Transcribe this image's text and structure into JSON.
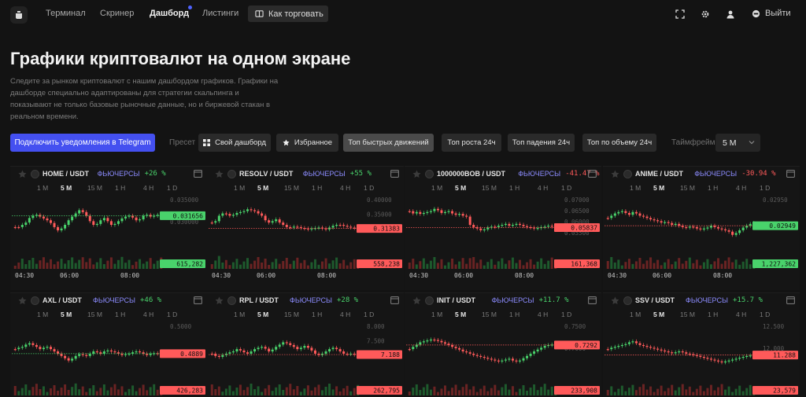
{
  "nav": {
    "items": [
      {
        "label": "Терминал",
        "active": false
      },
      {
        "label": "Скринер",
        "active": false
      },
      {
        "label": "Дашборд",
        "active": true
      },
      {
        "label": "Листинги",
        "active": false
      }
    ],
    "howto_label": "Как торговать",
    "logout_label": "Выйти",
    "icons": [
      "fullscreen-icon",
      "gear-icon",
      "user-icon",
      "logout-icon"
    ]
  },
  "hero": {
    "title": "Графики криптовалют на одном экране",
    "description": "Следите за рынком криптовалют с нашим дашбордом графиков. Графики на дашборде специально адаптированы для стратегии скальпинга и показывают не только базовые рыночные данные, но и биржевой стакан в реальном времени."
  },
  "toolbar": {
    "telegram_label": "Подключить уведомления в Telegram",
    "preset_label": "Пресет",
    "presets": [
      {
        "label": "Свой дашборд",
        "icon": "grid-icon",
        "active": false
      },
      {
        "label": "Избранное",
        "icon": "star-icon",
        "active": false
      },
      {
        "label": "Топ быстрых движений",
        "icon": "",
        "active": true
      },
      {
        "label": "Топ роста 24ч",
        "icon": "",
        "active": false
      },
      {
        "label": "Топ падения 24ч",
        "icon": "",
        "active": false
      },
      {
        "label": "Топ по объему 24ч",
        "icon": "",
        "active": false
      }
    ],
    "timeframe_label": "Таймфрейм",
    "timeframe_value": "5 M"
  },
  "colors": {
    "accent": "#4450f0",
    "up": "#49d26b",
    "down": "#ff5a5a",
    "futures": "#8c8cff",
    "background": "#131313"
  },
  "timeframes": [
    "1 M",
    "5 M",
    "15 M",
    "1 H",
    "4 H",
    "1 D"
  ],
  "active_timeframe": "5 M",
  "chart_data": [
    {
      "type": "candlestick",
      "pair": "HOME / USDT",
      "market": "ФЬЮЧЕРСЫ",
      "change": "+26 %",
      "direction": "up",
      "price_label": "0.031656",
      "volume_label": "615,282",
      "ticks": [
        "0.035000",
        "0.030000"
      ],
      "times": [
        "04:30",
        "06:00",
        "08:00"
      ],
      "shape": [
        0.55,
        0.55,
        0.5,
        0.45,
        0.35,
        0.3,
        0.28,
        0.32,
        0.36,
        0.4,
        0.46,
        0.55,
        0.62,
        0.58,
        0.5,
        0.4,
        0.32,
        0.25,
        0.18,
        0.22,
        0.3,
        0.42,
        0.5,
        0.48,
        0.4,
        0.35,
        0.42,
        0.5,
        0.48,
        0.42,
        0.36,
        0.32,
        0.3,
        0.34,
        0.4,
        0.38,
        0.3,
        0.28,
        0.32,
        0.3,
        0.28,
        0.3
      ],
      "last_level": 0.3,
      "level_ref": 0.3
    },
    {
      "type": "candlestick",
      "pair": "RESOLV / USDT",
      "market": "ФЬЮЧЕРСЫ",
      "change": "+55 %",
      "direction": "up",
      "price_label": "0.31383",
      "volume_label": "558,238",
      "ticks": [
        "0.40000",
        "0.35000",
        "0.30000"
      ],
      "times": [
        "04:30",
        "06:00",
        "08:00"
      ],
      "shape": [
        0.45,
        0.42,
        0.3,
        0.25,
        0.26,
        0.3,
        0.28,
        0.24,
        0.22,
        0.2,
        0.16,
        0.18,
        0.2,
        0.25,
        0.3,
        0.4,
        0.45,
        0.42,
        0.38,
        0.45,
        0.5,
        0.55,
        0.56,
        0.54,
        0.55,
        0.57,
        0.58,
        0.6,
        0.58,
        0.57,
        0.56,
        0.58,
        0.6,
        0.56,
        0.52,
        0.5,
        0.5,
        0.52,
        0.54,
        0.56,
        0.57,
        0.58
      ],
      "last_level": 0.58,
      "level_ref": 0.5
    },
    {
      "type": "candlestick",
      "pair": "1000000BOB / USDT",
      "market": "ФЬЮЧЕРСЫ",
      "change": "-41.47 %",
      "direction": "down",
      "price_label": "0.05837",
      "volume_label": "161,368",
      "ticks": [
        "0.07000",
        "0.06500",
        "0.06000",
        "0.05500"
      ],
      "times": [
        "04:30",
        "06:00",
        "08:00"
      ],
      "shape": [
        0.2,
        0.25,
        0.22,
        0.26,
        0.24,
        0.22,
        0.2,
        0.15,
        0.18,
        0.24,
        0.22,
        0.2,
        0.25,
        0.28,
        0.26,
        0.3,
        0.32,
        0.5,
        0.55,
        0.58,
        0.62,
        0.6,
        0.56,
        0.54,
        0.55,
        0.52,
        0.5,
        0.48,
        0.52,
        0.5,
        0.48,
        0.5,
        0.53,
        0.55,
        0.56,
        0.58,
        0.57,
        0.55,
        0.54,
        0.52,
        0.54,
        0.56
      ],
      "last_level": 0.56,
      "level_ref": 0.56
    },
    {
      "type": "candlestick",
      "pair": "ANIME / USDT",
      "market": "ФЬЮЧЕРСЫ",
      "change": "-30.94 %",
      "direction": "down",
      "price_label": "0.02949",
      "volume_label": "1,227,362",
      "ticks": [
        "0.02950"
      ],
      "times": [
        "04:30",
        "06:00",
        "08:00"
      ],
      "shape": [
        0.35,
        0.3,
        0.25,
        0.22,
        0.2,
        0.24,
        0.28,
        0.22,
        0.25,
        0.3,
        0.32,
        0.35,
        0.38,
        0.4,
        0.42,
        0.45,
        0.44,
        0.46,
        0.5,
        0.48,
        0.52,
        0.55,
        0.56,
        0.54,
        0.55,
        0.58,
        0.6,
        0.58,
        0.56,
        0.52,
        0.55,
        0.58,
        0.6,
        0.62,
        0.65,
        0.72,
        0.68,
        0.62,
        0.56,
        0.52,
        0.48,
        0.46
      ],
      "last_level": 0.52,
      "level_ref": 0.52
    },
    {
      "type": "candlestick",
      "pair": "AXL / USDT",
      "market": "ФЬЮЧЕРСЫ",
      "change": "+46 %",
      "direction": "up",
      "price_label": "0.4889",
      "volume_label": "426,283",
      "ticks": [
        "0.5000"
      ],
      "times": [],
      "shape": [
        0.45,
        0.42,
        0.4,
        0.35,
        0.32,
        0.36,
        0.4,
        0.45,
        0.42,
        0.4,
        0.45,
        0.5,
        0.55,
        0.6,
        0.65,
        0.7,
        0.66,
        0.6,
        0.56,
        0.58,
        0.6,
        0.55,
        0.5,
        0.52,
        0.55,
        0.5,
        0.48,
        0.5,
        0.52,
        0.55,
        0.58,
        0.56,
        0.55,
        0.52,
        0.5,
        0.52,
        0.55,
        0.58,
        0.55,
        0.54,
        0.55,
        0.56
      ],
      "last_level": 0.55,
      "level_ref": 0.55
    },
    {
      "type": "candlestick",
      "pair": "RPL / USDT",
      "market": "ФЬЮЧЕРСЫ",
      "change": "+28 %",
      "direction": "up",
      "price_label": "7.188",
      "volume_label": "262,795",
      "ticks": [
        "8.000",
        "7.500",
        "7.000"
      ],
      "times": [],
      "shape": [
        0.55,
        0.6,
        0.62,
        0.58,
        0.55,
        0.52,
        0.5,
        0.45,
        0.48,
        0.52,
        0.55,
        0.5,
        0.45,
        0.42,
        0.4,
        0.44,
        0.5,
        0.46,
        0.4,
        0.35,
        0.3,
        0.32,
        0.36,
        0.4,
        0.45,
        0.42,
        0.38,
        0.42,
        0.48,
        0.55,
        0.58,
        0.55,
        0.5,
        0.45,
        0.42,
        0.45,
        0.5,
        0.55,
        0.56,
        0.55,
        0.57,
        0.56
      ],
      "last_level": 0.57,
      "level_ref": 0.57
    },
    {
      "type": "candlestick",
      "pair": "INIT / USDT",
      "market": "ФЬЮЧЕРСЫ",
      "change": "+11.7 %",
      "direction": "up",
      "price_label": "0.7292",
      "volume_label": "233,908",
      "ticks": [
        "0.7500",
        "0.7000"
      ],
      "times": [],
      "shape": [
        0.45,
        0.4,
        0.35,
        0.3,
        0.28,
        0.26,
        0.24,
        0.25,
        0.27,
        0.3,
        0.33,
        0.36,
        0.4,
        0.43,
        0.46,
        0.5,
        0.52,
        0.55,
        0.58,
        0.6,
        0.62,
        0.64,
        0.66,
        0.68,
        0.7,
        0.72,
        0.7,
        0.68,
        0.66,
        0.7,
        0.72,
        0.7,
        0.65,
        0.6,
        0.55,
        0.5,
        0.46,
        0.42,
        0.38,
        0.36,
        0.35,
        0.34
      ],
      "last_level": 0.36,
      "level_ref": 0.36
    },
    {
      "type": "candlestick",
      "pair": "SSV / USDT",
      "market": "ФЬЮЧЕРСЫ",
      "change": "+15.7 %",
      "direction": "up",
      "price_label": "11.288",
      "volume_label": "23,579",
      "ticks": [
        "12.500",
        "12.000"
      ],
      "times": [],
      "shape": [
        0.45,
        0.42,
        0.4,
        0.38,
        0.36,
        0.34,
        0.3,
        0.28,
        0.32,
        0.36,
        0.38,
        0.4,
        0.42,
        0.44,
        0.46,
        0.48,
        0.5,
        0.52,
        0.54,
        0.52,
        0.5,
        0.52,
        0.55,
        0.56,
        0.58,
        0.6,
        0.62,
        0.64,
        0.66,
        0.68,
        0.7,
        0.72,
        0.74,
        0.72,
        0.7,
        0.68,
        0.66,
        0.64,
        0.62,
        0.6,
        0.59,
        0.58
      ],
      "last_level": 0.58,
      "level_ref": 0.58
    }
  ]
}
